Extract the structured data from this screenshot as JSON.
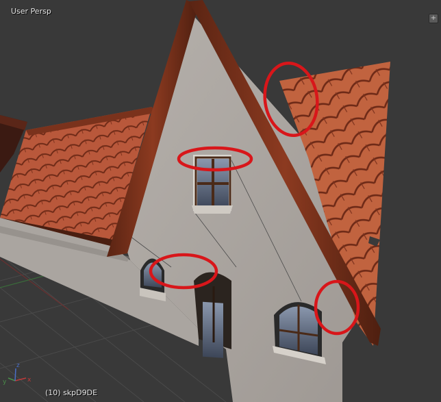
{
  "viewport": {
    "view_name": "User Persp",
    "object_info": "(10) skpD9DE",
    "corner_widget_icon": "plus-icon",
    "colors": {
      "background": "#393939",
      "grid_line": "#4a4a4a",
      "x_axis": "#c03a3a",
      "y_axis": "#4a8f4a",
      "roof_tile": "#b4553a",
      "wall": "#a9a49f",
      "annotation_circle": "#d8161a"
    }
  },
  "axis_gizmo": {
    "x_label": "x",
    "y_label": "y",
    "z_label": "z"
  },
  "annotations": {
    "count": 4,
    "shape": "red ellipse highlight"
  }
}
